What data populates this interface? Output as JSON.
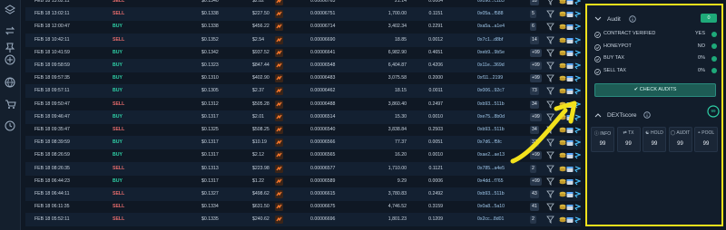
{
  "rail": {
    "icons": [
      "layers-icon",
      "swap-icon",
      "pin-icon",
      "plus-circle-icon",
      "globe-icon",
      "cart-icon",
      "clock-icon"
    ]
  },
  "table": {
    "rows": [
      {
        "date": "FEB 18 13:02:11",
        "type": "SELL",
        "price": "$0.1340",
        "total": "$2.82",
        "amount": "0.00006763",
        "tokens": "21.14",
        "quote": "0.0004",
        "maker": "0x090...c1b3",
        "count": "18"
      },
      {
        "date": "FEB 18 13:02:11",
        "type": "SELL",
        "price": "$0.1338",
        "total": "$227.50",
        "amount": "0.00006751",
        "tokens": "1,700.00",
        "quote": "0.1151",
        "maker": "0x05a...f588",
        "count": "5"
      },
      {
        "date": "FEB 18 12:00:47",
        "type": "BUY",
        "price": "$0.1338",
        "total": "$456.22",
        "amount": "0.00006714",
        "tokens": "3,402.34",
        "quote": "0.2291",
        "maker": "0xa5a...a1e4",
        "count": "6"
      },
      {
        "date": "FEB 18 10:42:11",
        "type": "SELL",
        "price": "$0.1352",
        "total": "$2.54",
        "amount": "0.00006690",
        "tokens": "18.85",
        "quote": "0.0012",
        "maker": "0x7c1...d8bf",
        "count": "14"
      },
      {
        "date": "FEB 18 10:41:59",
        "type": "BUY",
        "price": "$0.1342",
        "total": "$937.52",
        "amount": "0.00006641",
        "tokens": "6,982.90",
        "quote": "0.4651",
        "maker": "0xeb9...9b5e",
        "count": "+99"
      },
      {
        "date": "FEB 18 09:58:59",
        "type": "BUY",
        "price": "$0.1323",
        "total": "$847.44",
        "amount": "0.00006548",
        "tokens": "6,404.87",
        "quote": "0.4206",
        "maker": "0x11e...369d",
        "count": "+99"
      },
      {
        "date": "FEB 18 09:57:35",
        "type": "BUY",
        "price": "$0.1310",
        "total": "$402.90",
        "amount": "0.00006483",
        "tokens": "3,075.58",
        "quote": "0.2000",
        "maker": "0xf11...2199",
        "count": "+99"
      },
      {
        "date": "FEB 18 09:57:11",
        "type": "BUY",
        "price": "$0.1305",
        "total": "$2.37",
        "amount": "0.00006462",
        "tokens": "18.15",
        "quote": "0.0011",
        "maker": "0x006...92c7",
        "count": "73"
      },
      {
        "date": "FEB 18 09:50:47",
        "type": "SELL",
        "price": "$0.1312",
        "total": "$505.28",
        "amount": "0.00006488",
        "tokens": "3,860.40",
        "quote": "0.2497",
        "maker": "0xb93...511b",
        "count": "34"
      },
      {
        "date": "FEB 18 09:46:47",
        "type": "BUY",
        "price": "$0.1317",
        "total": "$2.01",
        "amount": "0.00006514",
        "tokens": "15.30",
        "quote": "0.0010",
        "maker": "0xe75...8b0d",
        "count": "+99"
      },
      {
        "date": "FEB 18 09:35:47",
        "type": "SELL",
        "price": "$0.1325",
        "total": "$508.25",
        "amount": "0.00006540",
        "tokens": "3,838.84",
        "quote": "0.2503",
        "maker": "0xb93...511b",
        "count": "34"
      },
      {
        "date": "FEB 18 08:39:59",
        "type": "BUY",
        "price": "$0.1317",
        "total": "$10.19",
        "amount": "0.00006566",
        "tokens": "77.37",
        "quote": "0.0051",
        "maker": "0x7d6...f5fc",
        "count": "37"
      },
      {
        "date": "FEB 18 08:26:59",
        "type": "BUY",
        "price": "$0.1317",
        "total": "$2.12",
        "amount": "0.00006565",
        "tokens": "16.20",
        "quote": "0.0010",
        "maker": "0xae2...ae13",
        "count": "+99"
      },
      {
        "date": "FEB 18 08:26:35",
        "type": "SELL",
        "price": "$0.1313",
        "total": "$223.98",
        "amount": "0.00006577",
        "tokens": "1,710.00",
        "quote": "0.1121",
        "maker": "0x785...a4e5",
        "count": "2"
      },
      {
        "date": "FEB 18 06:44:23",
        "type": "BUY",
        "price": "$0.1317",
        "total": "$1.22",
        "amount": "0.00006589",
        "tokens": "9.29",
        "quote": "0.0006",
        "maker": "0x4dd...f765",
        "count": "+99"
      },
      {
        "date": "FEB 18 06:44:11",
        "type": "SELL",
        "price": "$0.1327",
        "total": "$498.62",
        "amount": "0.00006615",
        "tokens": "3,780.83",
        "quote": "0.2492",
        "maker": "0xb93...511b",
        "count": "43"
      },
      {
        "date": "FEB 18 06:11:35",
        "type": "SELL",
        "price": "$0.1334",
        "total": "$631.50",
        "amount": "0.00006675",
        "tokens": "4,746.52",
        "quote": "0.3159",
        "maker": "0x0a8...5a10",
        "count": "41"
      },
      {
        "date": "FEB 18 05:52:11",
        "type": "SELL",
        "price": "$0.1335",
        "total": "$240.62",
        "amount": "0.00006696",
        "tokens": "1,801.23",
        "quote": "0.1209",
        "maker": "0x2cc...8d01",
        "count": "2"
      }
    ]
  },
  "audit": {
    "title": "Audit",
    "badge": "0",
    "items": [
      {
        "label": "CONTRACT VERIFIED",
        "value": "YES",
        "dot": "#1ea979"
      },
      {
        "label": "HONEYPOT",
        "value": "NO",
        "dot": "#1ea979"
      },
      {
        "label": "BUY TAX",
        "value": "0%",
        "dot": "#1ea979"
      },
      {
        "label": "SELL TAX",
        "value": "0%",
        "dot": "#1ea979"
      }
    ],
    "button": "CHECK AUDITS"
  },
  "dextscore": {
    "title": "DEXTscore",
    "score": "99",
    "cards": [
      {
        "label": "INFO",
        "value": "99",
        "icon": "info-icon"
      },
      {
        "label": "TX",
        "value": "99",
        "icon": "swap-icon"
      },
      {
        "label": "HOLD",
        "value": "99",
        "icon": "users-icon"
      },
      {
        "label": "AUDIT",
        "value": "99",
        "icon": "shield-icon"
      },
      {
        "label": "POOL",
        "value": "99",
        "icon": "database-icon"
      }
    ]
  },
  "colors": {
    "highlight": "#f2e11c",
    "buy": "#2fd1a7",
    "sell": "#e46b6b",
    "accent": "#1ea979"
  }
}
